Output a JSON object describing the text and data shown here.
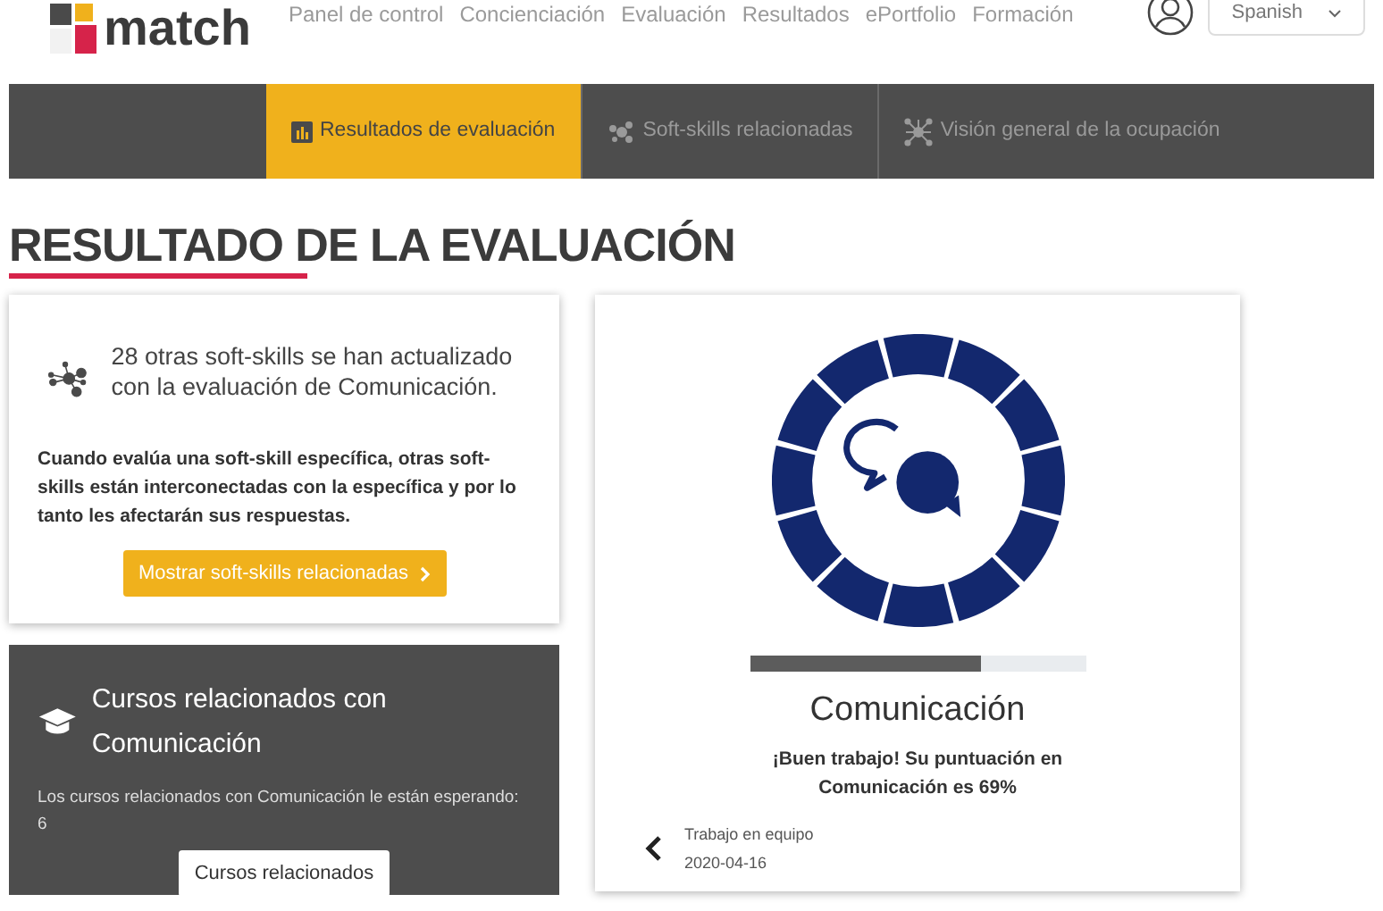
{
  "header": {
    "logo_text": "match",
    "nav": [
      {
        "label": "Panel de control"
      },
      {
        "label": "Concienciación"
      },
      {
        "label": "Evaluación"
      },
      {
        "label": "Resultados"
      },
      {
        "label": "ePortfolio"
      },
      {
        "label": "Formación"
      }
    ],
    "language": "Spanish"
  },
  "tabs": [
    {
      "label": "Resultados de evaluación",
      "selected": true,
      "kind": "chart"
    },
    {
      "label": "Soft-skills relacionadas",
      "selected": false,
      "kind": "cluster"
    },
    {
      "label": "Visión general de la ocupación",
      "selected": false,
      "kind": "network"
    }
  ],
  "page_title": "RESULTADO DE LA EVALUACIÓN",
  "related_card": {
    "headline": "28 otras soft-skills se han actualizado con la evaluación de Comunicación.",
    "body": "Cuando evalúa una soft-skill específica, otras soft-skills están interconectadas con la específica y por lo tanto les afectarán sus respuestas.",
    "button": "Mostrar soft-skills relacionadas"
  },
  "courses_card": {
    "title": "Cursos relacionados con Comunicación",
    "text": "Los cursos relacionados con Comunicación le están esperando: 6",
    "button": "Cursos relacionados"
  },
  "result_card": {
    "level": 0.69,
    "skill": "Comunicación",
    "message": "¡Buen trabajo! Su puntuación en Comunicación es 69%",
    "previous": {
      "skill": "Trabajo en equipo",
      "date": "2020-04-16"
    }
  }
}
